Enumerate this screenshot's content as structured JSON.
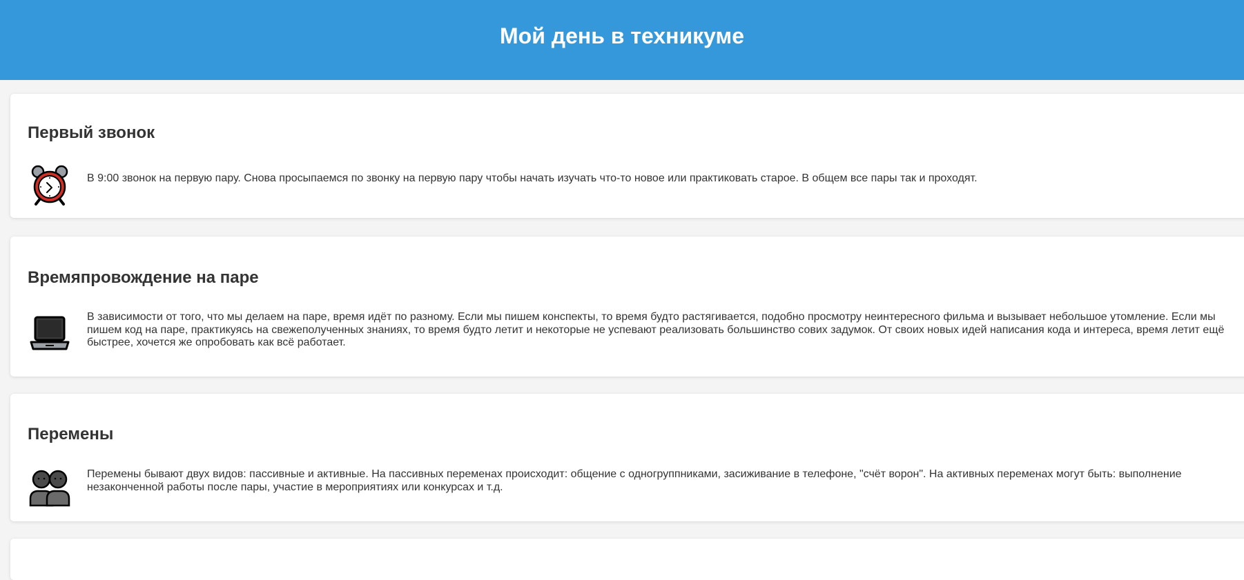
{
  "header": {
    "title": "Мой день в техникуме",
    "bg_color": "#3498db"
  },
  "sections": [
    {
      "title": "Первый звонок",
      "icon": "alarm-clock-icon",
      "text": "В 9:00 звонок на первую пару. Снова просыпаемся по звонку на первую пару чтобы начать изучать что-то новое или практиковать старое. В общем все пары так и проходят."
    },
    {
      "title": "Времяпровождение на паре",
      "icon": "laptop-icon",
      "text": "В зависимости от того, что мы делаем на паре, время идёт по разному. Если мы пишем конспекты, то время будто растягивается, подобно просмотру неинтересного фильма и вызывает небольшое утомление. Если мы пишем код на паре, практикуясь на свежеполученных знаниях, то время будто летит и некоторые не успевают реализовать большинство сових задумок. От своих новых идей написания кода и интереса, время летит ещё быстрее, хочется же опробовать как всё работает."
    },
    {
      "title": "Перемены",
      "icon": "two-people-icon",
      "text": "Перемены бывают двух видов: пассивные и активные. На пассивных переменах происходит: общение с одногруппниками, засиживание в телефоне, \"счёт ворон\". На активных переменах могут быть: выполнение незаконченной работы после пары, участие в мероприятиях или конкурсах и т.д."
    }
  ]
}
